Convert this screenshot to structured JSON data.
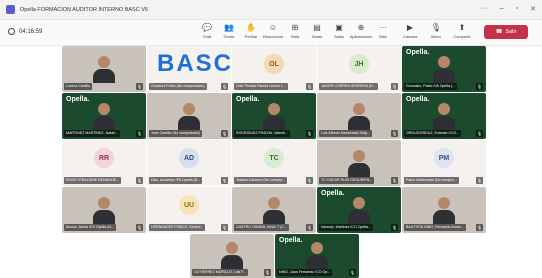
{
  "window": {
    "title": "Opella FORMACION AUDITOR INTERNO BASC V6"
  },
  "toolbar": {
    "timer": "04:16:59",
    "tools": [
      {
        "icon": "chat-icon",
        "glyph": "💬",
        "label": "Chat"
      },
      {
        "icon": "people-icon",
        "glyph": "👥",
        "label": "Gente"
      },
      {
        "icon": "raise-hand-icon",
        "glyph": "✋",
        "label": "Perfilar"
      },
      {
        "icon": "reactions-icon",
        "glyph": "☺",
        "label": "Reaccionar"
      },
      {
        "icon": "view-icon",
        "glyph": "⊞",
        "label": "Vista"
      },
      {
        "icon": "notes-icon",
        "glyph": "▤",
        "label": "Notas"
      },
      {
        "icon": "rooms-icon",
        "glyph": "▣",
        "label": "Salas"
      },
      {
        "icon": "apps-icon",
        "glyph": "⊕",
        "label": "Aplicaciones"
      },
      {
        "icon": "more-icon",
        "glyph": "···",
        "label": "Más"
      }
    ],
    "right_tools": [
      {
        "icon": "camera-icon",
        "glyph": "▶",
        "label": "Cámara"
      },
      {
        "icon": "mic-icon",
        "glyph": "🎙",
        "label": "Micro"
      },
      {
        "icon": "share-icon",
        "glyph": "⬆",
        "label": "Compartir"
      }
    ],
    "leave_label": "Salir"
  },
  "participants": [
    {
      "name": "Lorena Castillo",
      "kind": "video"
    },
    {
      "name": "Giovanni Prieto (No comprobado)",
      "kind": "banner",
      "banner": "BASC"
    },
    {
      "name": "Ortiz Peralta Fausto Leonel L...",
      "kind": "avatar",
      "initials": "OL",
      "bg": "#f6d9b4",
      "fg": "#8a5a1d"
    },
    {
      "name": "JAVIER CORREA HERRERA (N...",
      "kind": "avatar",
      "initials": "JH",
      "bg": "#d8ebd1",
      "fg": "#3d6b2f"
    },
    {
      "name": "Gonzalez, Pablo /VA Opella (...",
      "kind": "green",
      "logo": "Opella."
    },
    {
      "name": "MARTINEZ MARTINEZ, Natali...",
      "kind": "green",
      "logo": "Opella."
    },
    {
      "name": "Jose Castillo (No comprobado)",
      "kind": "video"
    },
    {
      "name": "RODRIGUEZ PINZON, Valenti...",
      "kind": "green",
      "logo": "Opella."
    },
    {
      "name": "Luis Alfredo Maldonado Salg...",
      "kind": "video"
    },
    {
      "name": "ORDUZ/ORDUZ, Estevan /CO/...",
      "kind": "green",
      "logo": "Opella."
    },
    {
      "name": "ROSA YERALDINE BENAVIDE...",
      "kind": "avatar",
      "initials": "RR",
      "bg": "#f4d3d8",
      "fg": "#8b3a4a"
    },
    {
      "name": "Diaz, Araceliyn /PA Opella (N...",
      "kind": "avatar",
      "initials": "AD",
      "bg": "#d6dff0",
      "fg": "#3b4f7a"
    },
    {
      "name": "Tatiana Cardona (No compro...",
      "kind": "avatar",
      "initials": "TC",
      "bg": "#d8ecd4",
      "fg": "#3d6b2f"
    },
    {
      "name": "TC OSCAR RUIS GEOURIEN...",
      "kind": "video"
    },
    {
      "name": "Pablo Maldonado (No compro...",
      "kind": "avatar",
      "initials": "PM",
      "bg": "#dfe3f2",
      "fg": "#3f4d8a"
    },
    {
      "name": "Munoz, Alexis /ES Opella (N...",
      "kind": "video"
    },
    {
      "name": "HERNANDEZ PONCE, Gerard...",
      "kind": "avatar",
      "initials": "UU",
      "bg": "#f6e4b8",
      "fg": "#8a6a1d"
    },
    {
      "name": "CASTRO OSMNA, Kevin T (C...",
      "kind": "video"
    },
    {
      "name": "Naranjo, Martinez /CO Opella...",
      "kind": "green",
      "logo": "Opella."
    },
    {
      "name": "BAUTISTA NINO, Fernando Andre...",
      "kind": "video"
    },
    {
      "name": "GUTIERREZ MURILLO, Luis F...",
      "kind": "video"
    },
    {
      "name": "NINO, Juan Fernando /CO Op...",
      "kind": "green",
      "logo": "Opella."
    }
  ],
  "mic_glyph": "🎙"
}
